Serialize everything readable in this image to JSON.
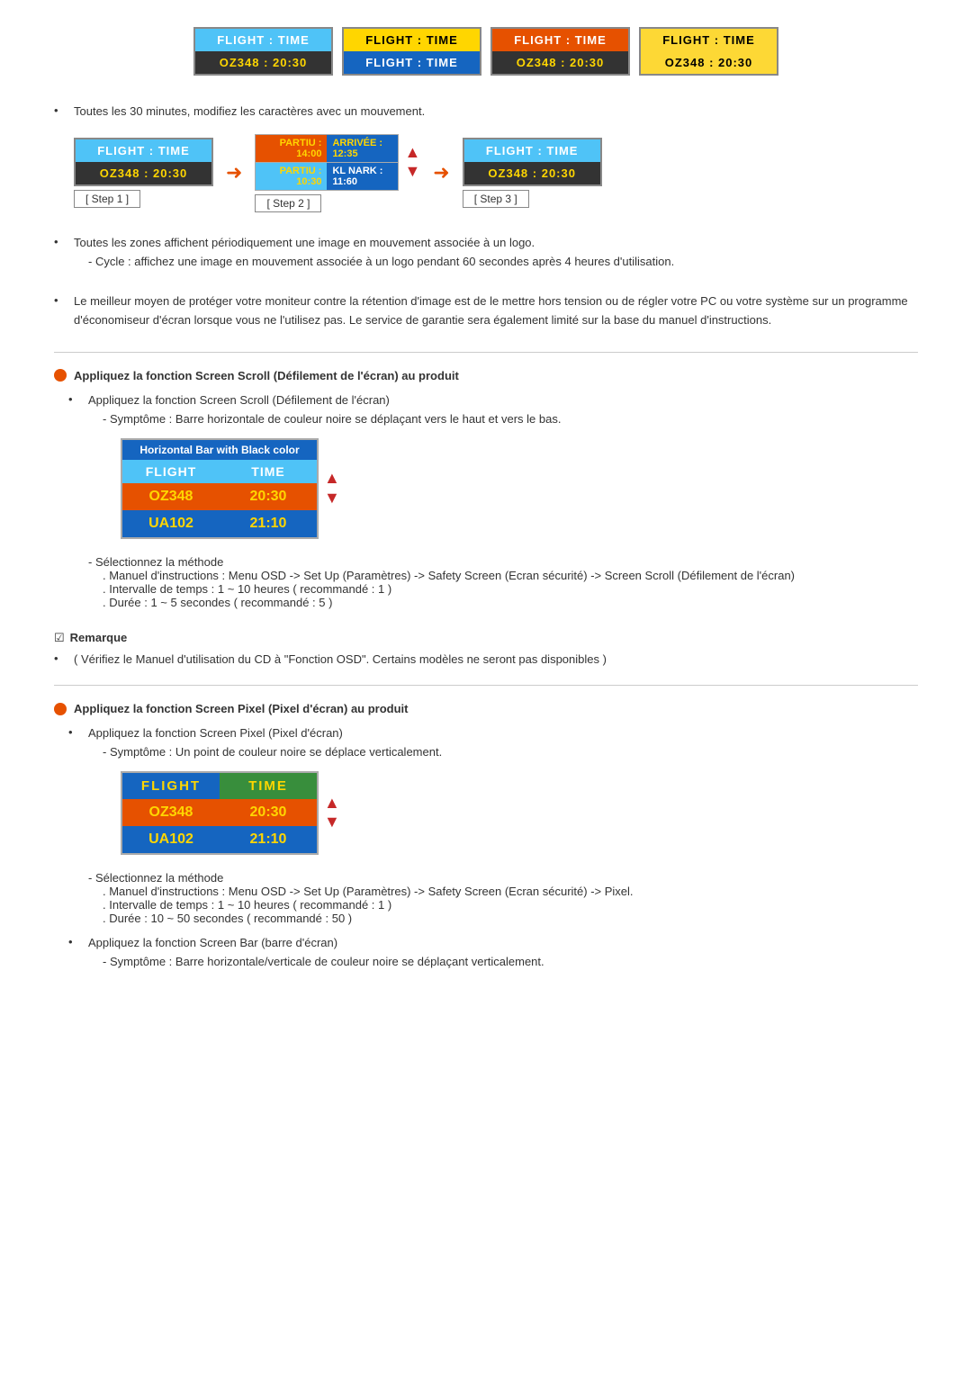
{
  "header": {
    "cards_row1": [
      {
        "top": "FLIGHT  :  TIME",
        "bottom": "OZ348   :  20:30",
        "topStyle": "blue",
        "bottomStyle": "dark"
      },
      {
        "top": "FLIGHT  :  TIME",
        "bottom": "FLIGHT  :  TIME",
        "topStyle": "yellow",
        "bottomStyle": "blue"
      },
      {
        "top": "FLIGHT  :  TIME",
        "bottom": "OZ348   :  20:30",
        "topStyle": "orange",
        "bottomStyle": "dark"
      },
      {
        "top": "FLIGHT  :  TIME",
        "bottom": "OZ348   :  20:30",
        "topStyle": "yellowlt",
        "bottomStyle": "dark"
      }
    ]
  },
  "section_30min": {
    "bullet": "Toutes les 30 minutes, modifiez les caractères avec un mouvement.",
    "step1_label": "[ Step 1 ]",
    "step2_label": "[ Step 2 ]",
    "step3_label": "[ Step 3 ]",
    "step1_top": "FLIGHT  :  TIME",
    "step1_bottom": "OZ348   :  20:30",
    "step2_row1_l": "PARTIU  :  14:00",
    "step2_row1_r": "ARRIVÉE :  12:35",
    "step2_row2_l": "PARTIU  :  10:30",
    "step2_row2_r": "KL NARK :  11:60",
    "step3_top": "FLIGHT  :  TIME",
    "step3_bottom": "OZ348   :  20:30"
  },
  "section_periodic": {
    "bullet": "Toutes les zones affichent périodiquement une image en mouvement associée à un logo.",
    "sub": "- Cycle : affichez une image en mouvement associée à un logo pendant 60 secondes après 4 heures d'utilisation."
  },
  "section_protection": {
    "bullet": "Le meilleur moyen de protéger votre moniteur contre la rétention d'image est de le mettre hors tension ou de régler votre PC ou votre système sur un programme d'économiseur d'écran lorsque vous ne l'utilisez pas. Le service de garantie sera également limité sur la base du manuel d'instructions."
  },
  "screen_scroll": {
    "header": "Appliquez la fonction Screen Scroll (Défilement de l'écran) au produit",
    "bullet1": "Appliquez la fonction Screen Scroll (Défilement de l'écran)",
    "symptom": "- Symptôme : Barre horizontale de couleur noire se déplaçant vers le haut et vers le bas.",
    "card_title": "Horizontal Bar with Black color",
    "card_row1_l": "FLIGHT",
    "card_row1_r": "TIME",
    "card_row2_l": "OZ348",
    "card_row2_r": "20:30",
    "card_row3_l": "UA102",
    "card_row3_r": "21:10",
    "select_method": "- Sélectionnez la méthode",
    "method_detail": ". Manuel d'instructions : Menu OSD -> Set Up (Paramètres) -> Safety Screen (Ecran sécurité) -> Screen Scroll (Défilement de l'écran)",
    "interval": ". Intervalle de temps : 1 ~ 10 heures ( recommandé : 1 )",
    "duration": ". Durée : 1 ~ 5 secondes ( recommandé : 5 )"
  },
  "remarque": {
    "label": "Remarque",
    "text": "( Vérifiez le Manuel d'utilisation du CD à \"Fonction OSD\". Certains modèles ne seront pas disponibles )"
  },
  "screen_pixel": {
    "header": "Appliquez la fonction Screen Pixel (Pixel d'écran) au produit",
    "bullet1": "Appliquez la fonction Screen Pixel (Pixel d'écran)",
    "symptom": "- Symptôme : Un point de couleur noire se déplace verticalement.",
    "card_row1_l": "FLIGHT",
    "card_row1_r": "TIME",
    "card_row2_l": "OZ348",
    "card_row2_r": "20:30",
    "card_row3_l": "UA102",
    "card_row3_r": "21:10",
    "select_method": "- Sélectionnez la méthode",
    "method_detail": ". Manuel d'instructions : Menu OSD -> Set Up (Paramètres) -> Safety Screen (Ecran sécurité) -> Pixel.",
    "interval": ". Intervalle de temps : 1 ~ 10 heures ( recommandé : 1 )",
    "duration": ". Durée : 10 ~ 50 secondes ( recommandé : 50 )",
    "bullet2": "Appliquez la fonction Screen Bar (barre d'écran)",
    "symptom2": "- Symptôme : Barre horizontale/verticale de couleur noire se déplaçant verticalement."
  }
}
